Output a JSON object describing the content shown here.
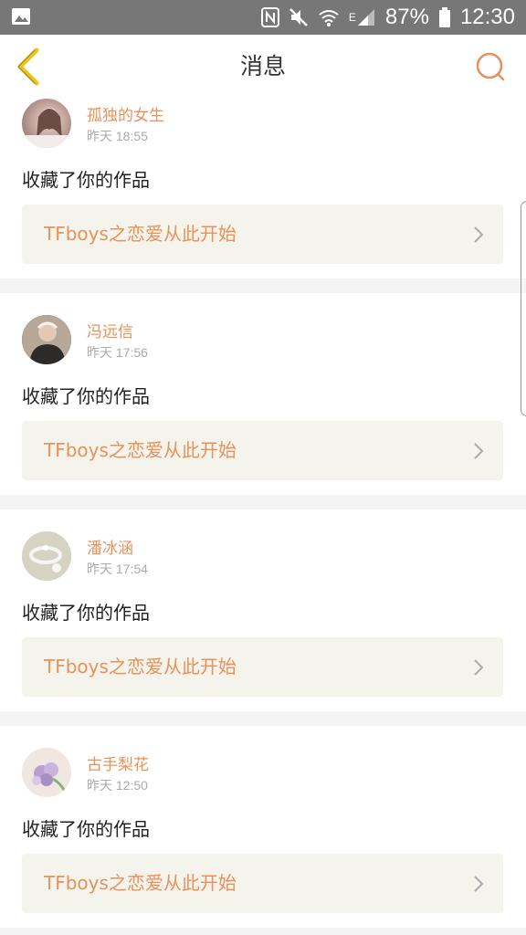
{
  "status_bar": {
    "battery": "87%",
    "time": "12:30",
    "network": "E",
    "icons": [
      "gallery-icon",
      "nfc-icon",
      "mute-icon",
      "wifi-icon",
      "signal-icon",
      "battery-icon"
    ]
  },
  "header": {
    "title": "消息",
    "back_icon": "chevron-left-icon",
    "search_icon": "search-icon"
  },
  "colors": {
    "accent": "#e8925a",
    "back_arrow": "#f0c419",
    "link_bg": "#f4f3ec",
    "status_bar": "#777777"
  },
  "notifications": [
    {
      "user": "孤独的女生",
      "time": "昨天 18:55",
      "action": "收藏了你的作品",
      "work": "TFboys之恋爱从此开始"
    },
    {
      "user": "冯远信",
      "time": "昨天 17:56",
      "action": "收藏了你的作品",
      "work": "TFboys之恋爱从此开始"
    },
    {
      "user": "潘冰涵",
      "time": "昨天 17:54",
      "action": "收藏了你的作品",
      "work": "TFboys之恋爱从此开始"
    },
    {
      "user": "古手梨花",
      "time": "昨天 12:50",
      "action": "收藏了你的作品",
      "work": "TFboys之恋爱从此开始"
    }
  ]
}
